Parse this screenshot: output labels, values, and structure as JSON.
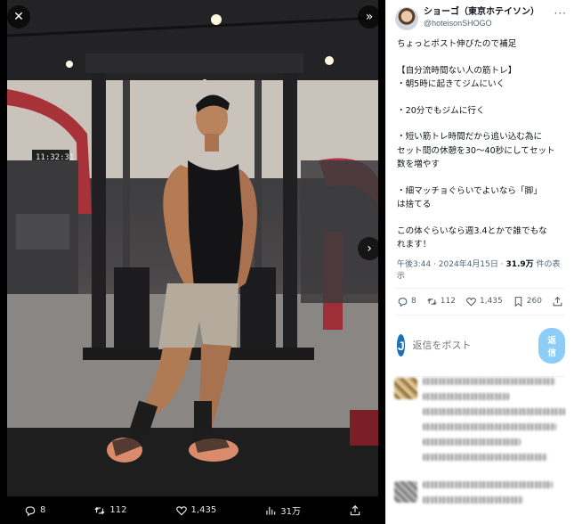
{
  "media": {
    "close_label": "✕",
    "expand_label": "»",
    "next_label": "›",
    "actions": [
      {
        "icon": "reply-icon",
        "value": "8"
      },
      {
        "icon": "retweet-icon",
        "value": "112"
      },
      {
        "icon": "like-icon",
        "value": "1,435"
      },
      {
        "icon": "views-icon",
        "value": "31万"
      },
      {
        "icon": "share-icon",
        "value": ""
      }
    ]
  },
  "tweet": {
    "author": {
      "display_name": "ショーゴ（東京ホテイソン）",
      "handle": "@hoteisonSHOGO"
    },
    "more_label": "···",
    "lines": [
      "ちょっとポスト伸びたので補足",
      "",
      "【自分流時間ない人の筋トレ】",
      "・朝5時に起きてジムにいく",
      "",
      "・20分でもジムに行く",
      "",
      "・短い筋トレ時間だから追い込む為に",
      "セット間の休憩を30〜40秒にしてセット",
      "数を増やす",
      "",
      "・細マッチョぐらいでよいなら「脚」",
      "は捨てる",
      "",
      "この体ぐらいなら週3.4とかで誰でもな",
      "れます！"
    ],
    "meta_prefix": "午後3:44 · 2024年4月15日 · ",
    "meta_views": "31.9万",
    "meta_suffix": " 件の表示",
    "actions": [
      {
        "icon": "reply-icon",
        "value": "8"
      },
      {
        "icon": "retweet-icon",
        "value": "112"
      },
      {
        "icon": "like-icon",
        "value": "1,435"
      },
      {
        "icon": "bookmark-icon",
        "value": "260"
      },
      {
        "icon": "share-icon",
        "value": ""
      }
    ]
  },
  "reply": {
    "avatar_letter": "J",
    "placeholder": "返信をポスト",
    "button_label": "返信"
  },
  "colors": {
    "accent": "#1d9bf0",
    "reply_button_disabled": "#8ecdf8",
    "text_primary": "#0f1419",
    "text_secondary": "#536471"
  }
}
